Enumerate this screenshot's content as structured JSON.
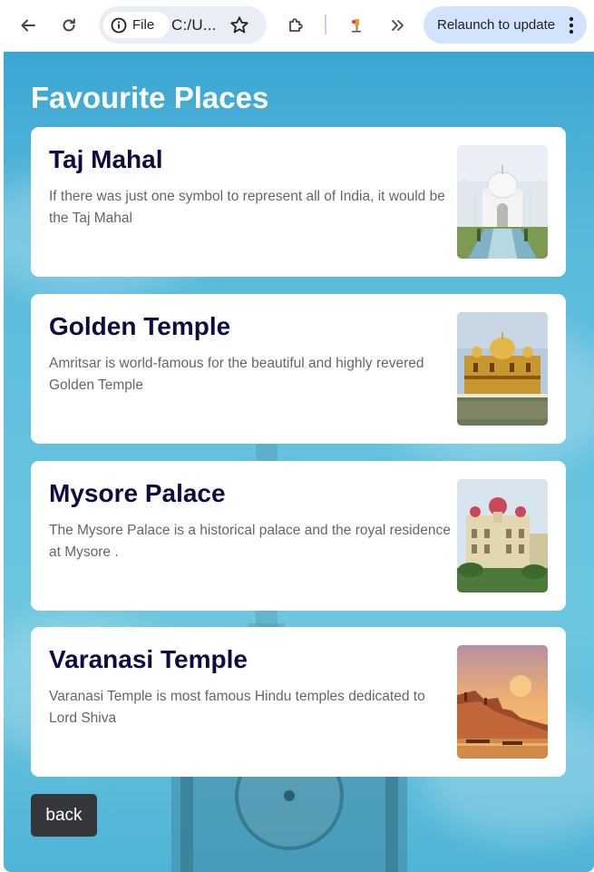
{
  "browser": {
    "chip_label": "File",
    "url": "C:/U...",
    "relaunch_label": "Relaunch to update"
  },
  "page": {
    "heading": "Favourite Places",
    "back_label": "back",
    "places": [
      {
        "title": "Taj Mahal",
        "description": "If there was just one symbol to represent all of India, it would be the Taj Mahal"
      },
      {
        "title": "Golden Temple",
        "description": "Amritsar is world-famous for the beautiful and highly revered Golden Temple"
      },
      {
        "title": "Mysore Palace",
        "description": "The Mysore Palace is a historical palace and the royal residence at Mysore ."
      },
      {
        "title": "Varanasi Temple",
        "description": "Varanasi Temple is most famous Hindu temples dedicated to Lord Shiva"
      }
    ]
  }
}
